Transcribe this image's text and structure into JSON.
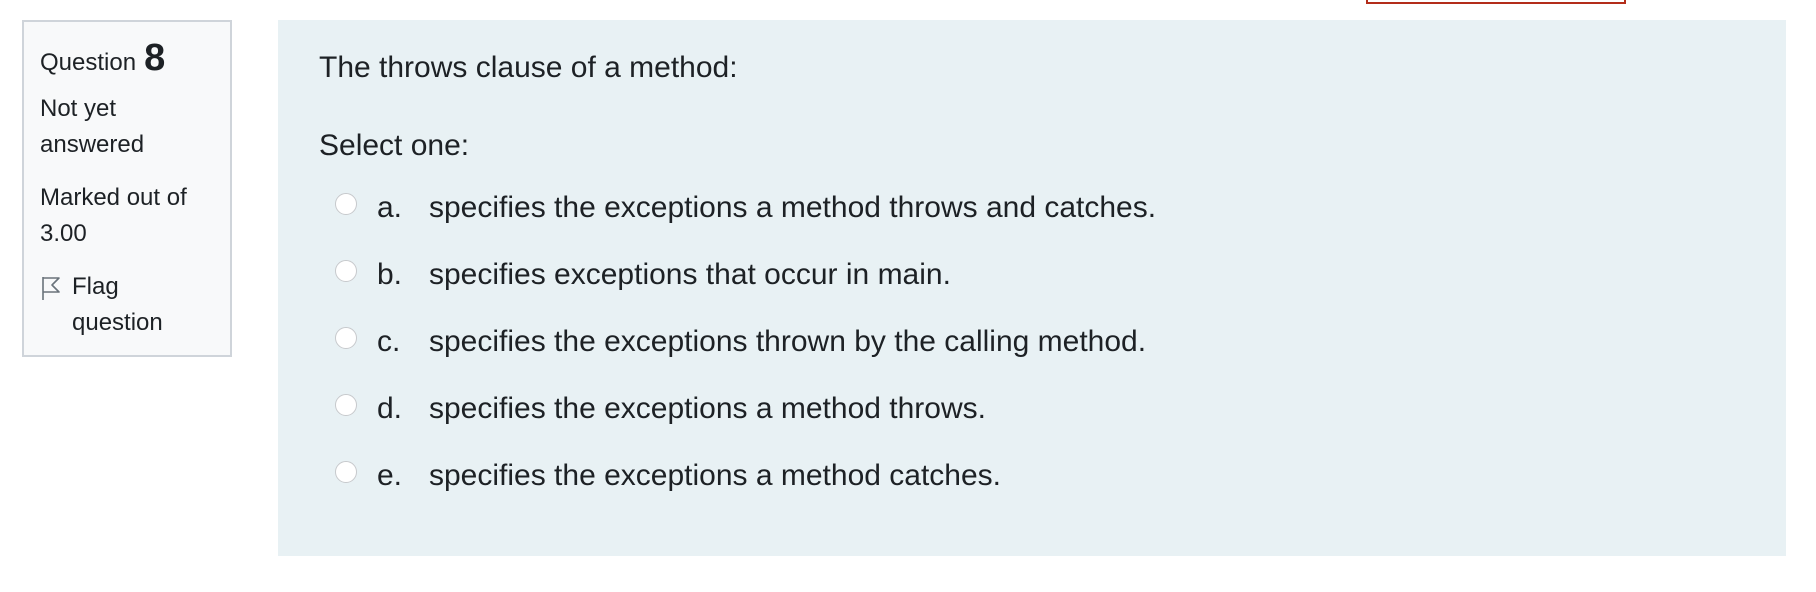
{
  "info": {
    "question_label": "Question",
    "question_number": "8",
    "state": "Not yet answered",
    "grade": "Marked out of 3.00",
    "flag_label": "Flag question",
    "flag_icon": "flag-outline-icon"
  },
  "question": {
    "text": "The throws clause of a method:",
    "prompt": "Select one:",
    "answers": [
      {
        "letter": "a.",
        "text": "specifies the exceptions a method throws and catches."
      },
      {
        "letter": "b.",
        "text": "specifies exceptions that occur in main."
      },
      {
        "letter": "c.",
        "text": "specifies the exceptions thrown by the calling method."
      },
      {
        "letter": "d.",
        "text": "specifies the exceptions a method throws."
      },
      {
        "letter": "e.",
        "text": "specifies the exceptions a method catches."
      }
    ]
  },
  "colors": {
    "content_bg": "#e8f1f4",
    "info_bg": "#f8f9fa",
    "info_border": "#cfd4da",
    "accent_red": "#b32d1a"
  }
}
